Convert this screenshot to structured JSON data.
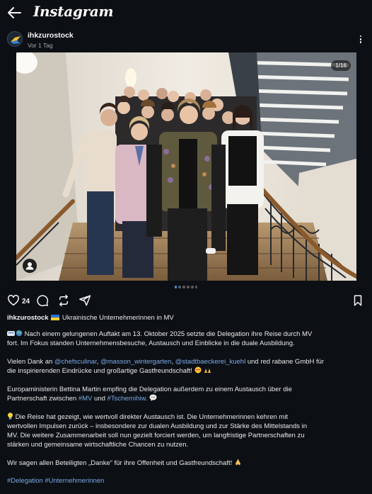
{
  "header": {
    "title": "Instagram"
  },
  "post": {
    "username": "ihkzurostock",
    "time": "Vor 1 Tag",
    "image_counter": "1/16",
    "likes": "24",
    "slide_count": 6,
    "active_slide": 1
  },
  "caption": {
    "username": "ihkzurostock",
    "title": "Ukrainische Unternehmerinnen in MV",
    "p1": {
      "l1_text": "Nach einem gelungenen Auftakt am 13. Oktober 2025 setzte die Delegation ihre Reise durch MV",
      "l2": "fort. Im Fokus standen Unternehmensbesuche, Austausch und Einblicke in die duale Ausbildung."
    },
    "p2": {
      "l1_a": "Vielen Dank an",
      "m1": "@chefsculinar",
      "m2": "@masson_wintergarten",
      "m3": "@stadtbaeckerei_kuehl",
      "l1_b": "und red rabane GmbH für",
      "l2": "die inspirierenden Eindrücke und großartige Gastfreundschaft!"
    },
    "p3": {
      "l1": "Europaministerin Bettina Martin empfing die Delegation außerdem zu einem Austausch über die",
      "l2_a": "Partnerschaft zwischen",
      "tag1": "#MV",
      "l2_b": "und",
      "tag2": "#Tschernihiw."
    },
    "p4": {
      "l1": "Die Reise hat gezeigt, wie wertvoll direkter Austausch ist. Die Unternehmerinnen kehren mit",
      "l2": "wertvollen Impulsen zurück – insbesondere zur dualen Ausbildung und zur Stärke des Mittelstands in",
      "l3": "MV. Die weitere Zusammenarbeit soll nun gezielt forciert werden, um langfristige Partnerschaften zu",
      "l4": "stärken und gemeinsame wirtschaftliche Chancen zu nutzen."
    },
    "p5": {
      "l1": "Wir sagen allen Beteiligten „Danke“ für ihre Offenheit und Gastfreundschaft!"
    },
    "hashtags": {
      "h1": "#Delegation",
      "h2": "#Unternehmerinnen"
    }
  },
  "colors": {
    "background": "#0c1014",
    "text": "#f5f5f5",
    "link": "#7aa9e8",
    "active_dot": "#3797f0"
  },
  "icons": {
    "back": "arrow-left-icon",
    "more": "more-vertical-icon",
    "like": "heart-icon",
    "comment": "comment-icon",
    "repost": "repost-icon",
    "share": "send-icon",
    "save": "bookmark-icon",
    "tag": "person-tag-icon"
  }
}
